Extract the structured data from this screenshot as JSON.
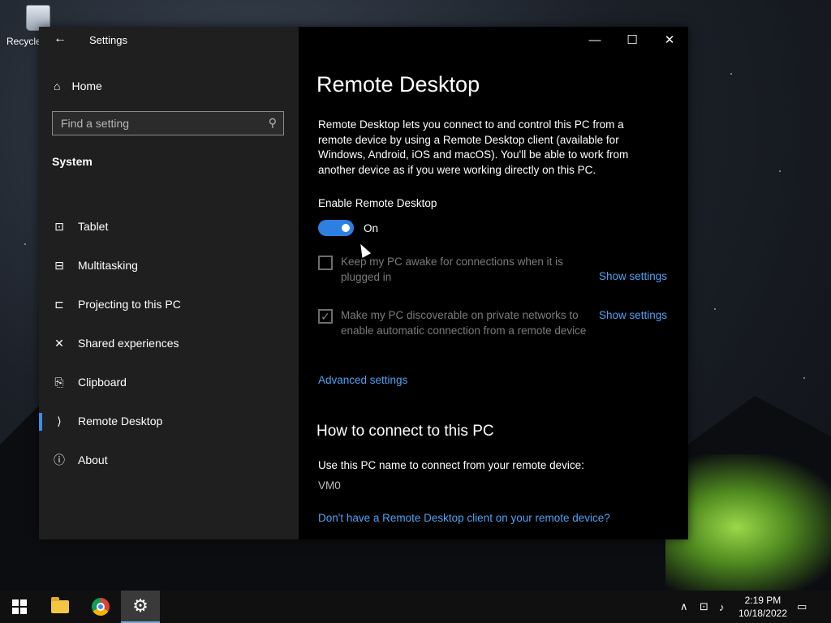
{
  "desktop": {
    "recycle_bin_label": "Recycle"
  },
  "window": {
    "title": "Settings",
    "back_glyph": "←",
    "min_glyph": "—",
    "max_glyph": "☐",
    "close_glyph": "✕"
  },
  "sidebar": {
    "home_label": "Home",
    "search_placeholder": "Find a setting",
    "section": "System",
    "items": [
      {
        "label": "Tablet",
        "icon": "tablet-icon",
        "glyph": "⊡"
      },
      {
        "label": "Multitasking",
        "icon": "multitasking-icon",
        "glyph": "⊟"
      },
      {
        "label": "Projecting to this PC",
        "icon": "projecting-icon",
        "glyph": "⊏"
      },
      {
        "label": "Shared experiences",
        "icon": "shared-experiences-icon",
        "glyph": "✕"
      },
      {
        "label": "Clipboard",
        "icon": "clipboard-icon",
        "glyph": "⎘"
      },
      {
        "label": "Remote Desktop",
        "icon": "remote-desktop-icon",
        "glyph": "⟩",
        "active": true
      },
      {
        "label": "About",
        "icon": "about-icon",
        "glyph": "ⓘ"
      }
    ]
  },
  "main": {
    "title": "Remote Desktop",
    "description": "Remote Desktop lets you connect to and control this PC from a remote device by using a Remote Desktop client (available for Windows, Android, iOS and macOS). You'll be able to work from another device as if you were working directly on this PC.",
    "enable_label": "Enable Remote Desktop",
    "toggle_state": "On",
    "toggle_on": true,
    "option1": {
      "text": "Keep my PC awake for connections when it is plugged in",
      "checked": false,
      "link": "Show settings"
    },
    "option2": {
      "text": "Make my PC discoverable on private networks to enable automatic connection from a remote device",
      "checked": true,
      "link": "Show settings"
    },
    "advanced_link": "Advanced settings",
    "how_to_title": "How to connect to this PC",
    "how_to_text": "Use this PC name to connect from your remote device:",
    "pc_name": "VM0",
    "client_link": "Don't have a Remote Desktop client on your remote device?"
  },
  "taskbar": {
    "time": "2:19 PM",
    "date": "10/18/2022",
    "accent": "#2d7fe0"
  }
}
